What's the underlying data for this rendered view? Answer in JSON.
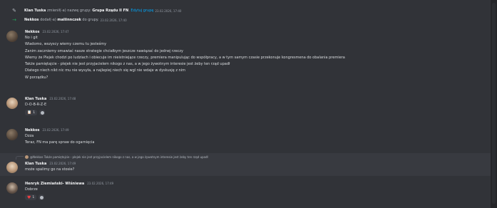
{
  "system_messages": [
    {
      "user": "Klan Tuska",
      "action": "zmienił(-a) nazwę grupy:",
      "group_name": "Grupa Rządu II FN",
      "link": "Edytuj grupę",
      "timestamp": "23.02.2026, 17:40",
      "icon": "pencil-icon"
    },
    {
      "user": "Nekkos",
      "action": "dodał(-a)",
      "target": "maliinnczek",
      "suffix": "do grupy.",
      "timestamp": "23.02.2026, 17:40",
      "icon": "arrow-right-icon"
    }
  ],
  "messages": [
    {
      "user": "Nekkos",
      "timestamp": "23.02.2026, 17:47",
      "lines": [
        "No i git",
        "Wiadomo, wszyscy wiemy czemu tu jesteśmy",
        "Zanim zaczniemy omawiać nasze strategie chciałbym jeszcze nawiązać do jednej rzeczy",
        "Wiemy że Plejek chodzi po ludziach i obiecuje im nieistniejące rzeczy, premiera manipulując do współpracy, a w tym samym czasie przekonuje kongresmena do obalania premiera",
        "Także pamiętajcie - plejek nie jest przyjacielem nikogo z nas, a w jego żywotnym interesie jest żeby ten rząd upadł",
        "Dlatego niech nikt nic mu nie wysyła, a najlepiej niech się wgl nie wdaje w dyskusję z nim",
        "W porządku?"
      ]
    },
    {
      "user": "Klan Tuska",
      "timestamp": "23.02.2026, 17:48",
      "lines": [
        "D-O-B-R-Z-E"
      ],
      "reactions": [
        {
          "emoji": "clipboard-icon",
          "glyph": "📋",
          "count": "1"
        }
      ]
    },
    {
      "user": "Nekkos",
      "timestamp": "23.02.2026, 17:49",
      "lines": [
        "Dzza",
        "Teraz, FN ma parę spraw do ogarnięcia"
      ]
    },
    {
      "reply": "@Nekkos Także pamiętajcie - plejek nie jest przyjacielem nikogo z nas, a w jego żywotnym interesie jest żeby ten rząd upadł",
      "user": "Klan Tuska",
      "timestamp": "23.02.2026, 17:49",
      "lines": [
        "może spalimy go na stosie?"
      ]
    },
    {
      "user": "Henryk Ziemiański- Wiśniewa",
      "timestamp": "23.02.2026, 17:49",
      "lines": [
        "Dobrze"
      ],
      "reactions": [
        {
          "emoji": "heart-icon",
          "glyph": "♥",
          "count": "1"
        }
      ]
    }
  ],
  "colors": {
    "background": "#313338",
    "link": "#00a8fc",
    "join_arrow": "#23a55a",
    "heart": "#f23f43"
  }
}
